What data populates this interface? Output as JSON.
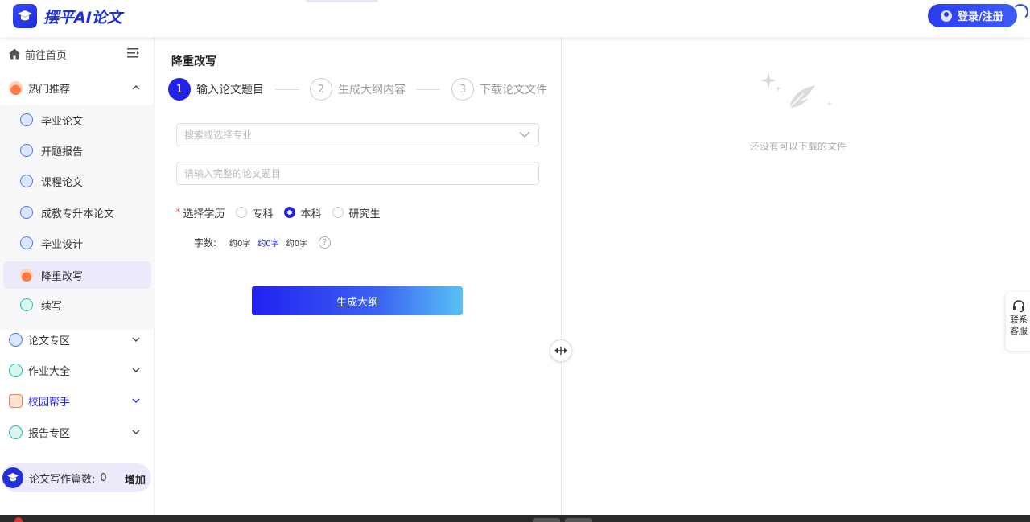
{
  "header": {
    "logo_text": "摆平AI论文",
    "login_label": "登录/注册"
  },
  "sidebar": {
    "home_label": "前往首页",
    "hot_group": "热门推荐",
    "sub_items": [
      {
        "label": "毕业论文",
        "icon": "doc-icon"
      },
      {
        "label": "开题报告",
        "icon": "doc-icon"
      },
      {
        "label": "课程论文",
        "icon": "doc-icon"
      },
      {
        "label": "成教专升本论文",
        "icon": "doc-icon"
      },
      {
        "label": "毕业设计",
        "icon": "doc-icon"
      },
      {
        "label": "降重改写",
        "icon": "hot-fire-icon",
        "active": true
      },
      {
        "label": "续写",
        "icon": "bars-icon"
      }
    ],
    "groups": [
      {
        "label": "论文专区",
        "icon": "doc-icon"
      },
      {
        "label": "作业大全",
        "icon": "bars-icon"
      },
      {
        "label": "校园帮手",
        "icon": "campus-icon",
        "highlight": true
      },
      {
        "label": "报告专区",
        "icon": "bars-icon"
      }
    ],
    "counter": {
      "label": "论文写作篇数:",
      "value": "0",
      "add_label": "增加"
    }
  },
  "main": {
    "title": "降重改写",
    "steps": [
      {
        "num": "1",
        "label": "输入论文题目",
        "active": true
      },
      {
        "num": "2",
        "label": "生成大纲内容"
      },
      {
        "num": "3",
        "label": "下载论文文件"
      }
    ],
    "major_placeholder": "搜索或选择专业",
    "topic_placeholder": "请输入完整的论文题目",
    "edu_label": "选择学历",
    "edu_options": [
      "专科",
      "本科",
      "研究生"
    ],
    "edu_selected": "本科",
    "words_label": "字数:",
    "word_options": [
      "约0字",
      "约0字",
      "约0字"
    ],
    "word_selected_index": 1,
    "help_symbol": "?",
    "generate_label": "生成大纲"
  },
  "right": {
    "empty_text": "还没有可以下载的文件"
  },
  "service": {
    "label": "联系客服"
  },
  "colors": {
    "accent": "#2323e8",
    "brand": "#1c2fd9",
    "active_bg": "#ece9fb"
  }
}
